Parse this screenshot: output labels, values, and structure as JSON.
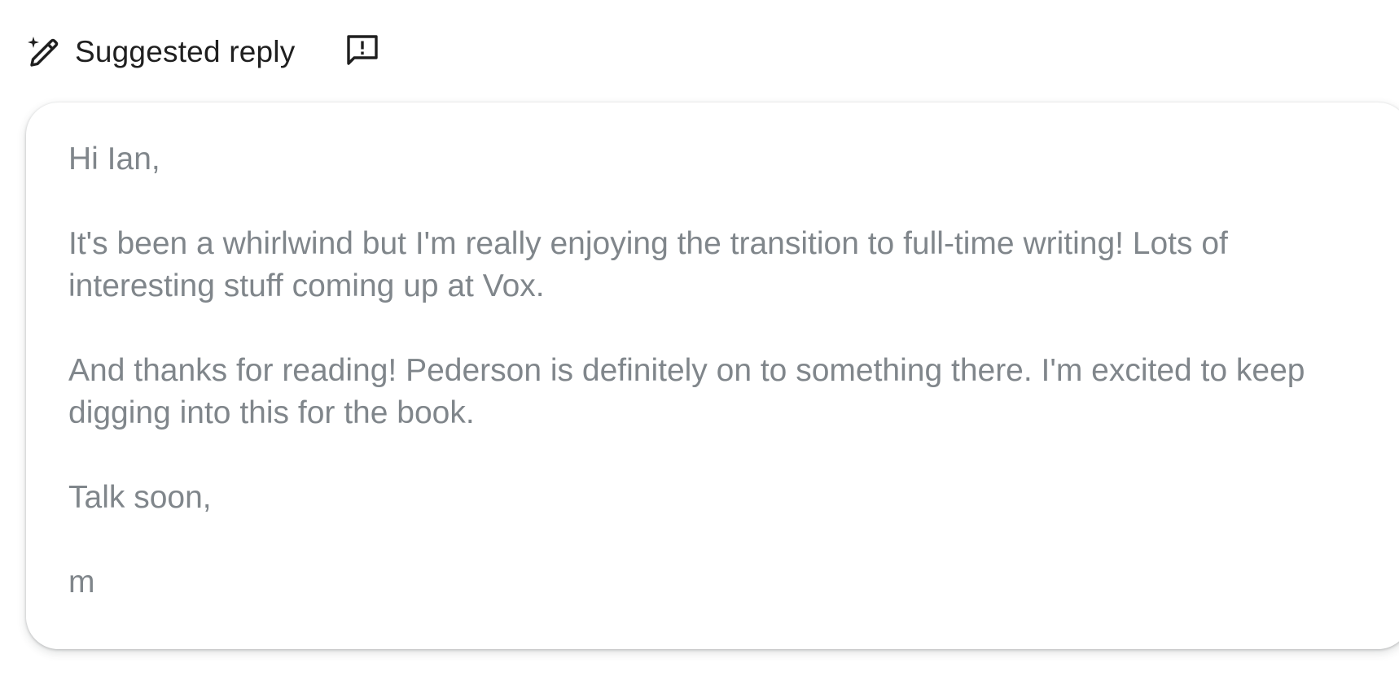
{
  "header": {
    "title": "Suggested reply",
    "icons": {
      "suggest": "magic-pen-icon",
      "feedback": "feedback-icon"
    }
  },
  "reply": {
    "greeting": "Hi Ian,",
    "paragraph_1": "It's been a whirlwind but I'm really enjoying the transition to full-time writing! Lots of interesting stuff coming up at Vox.",
    "paragraph_2": "And thanks for reading! Pederson is definitely on to something there. I'm excited to keep digging into this for the book.",
    "signoff": "Talk soon,",
    "signature": "m"
  },
  "colors": {
    "title": "#1f1f1f",
    "body_text": "#80868b",
    "card_background": "#ffffff"
  }
}
